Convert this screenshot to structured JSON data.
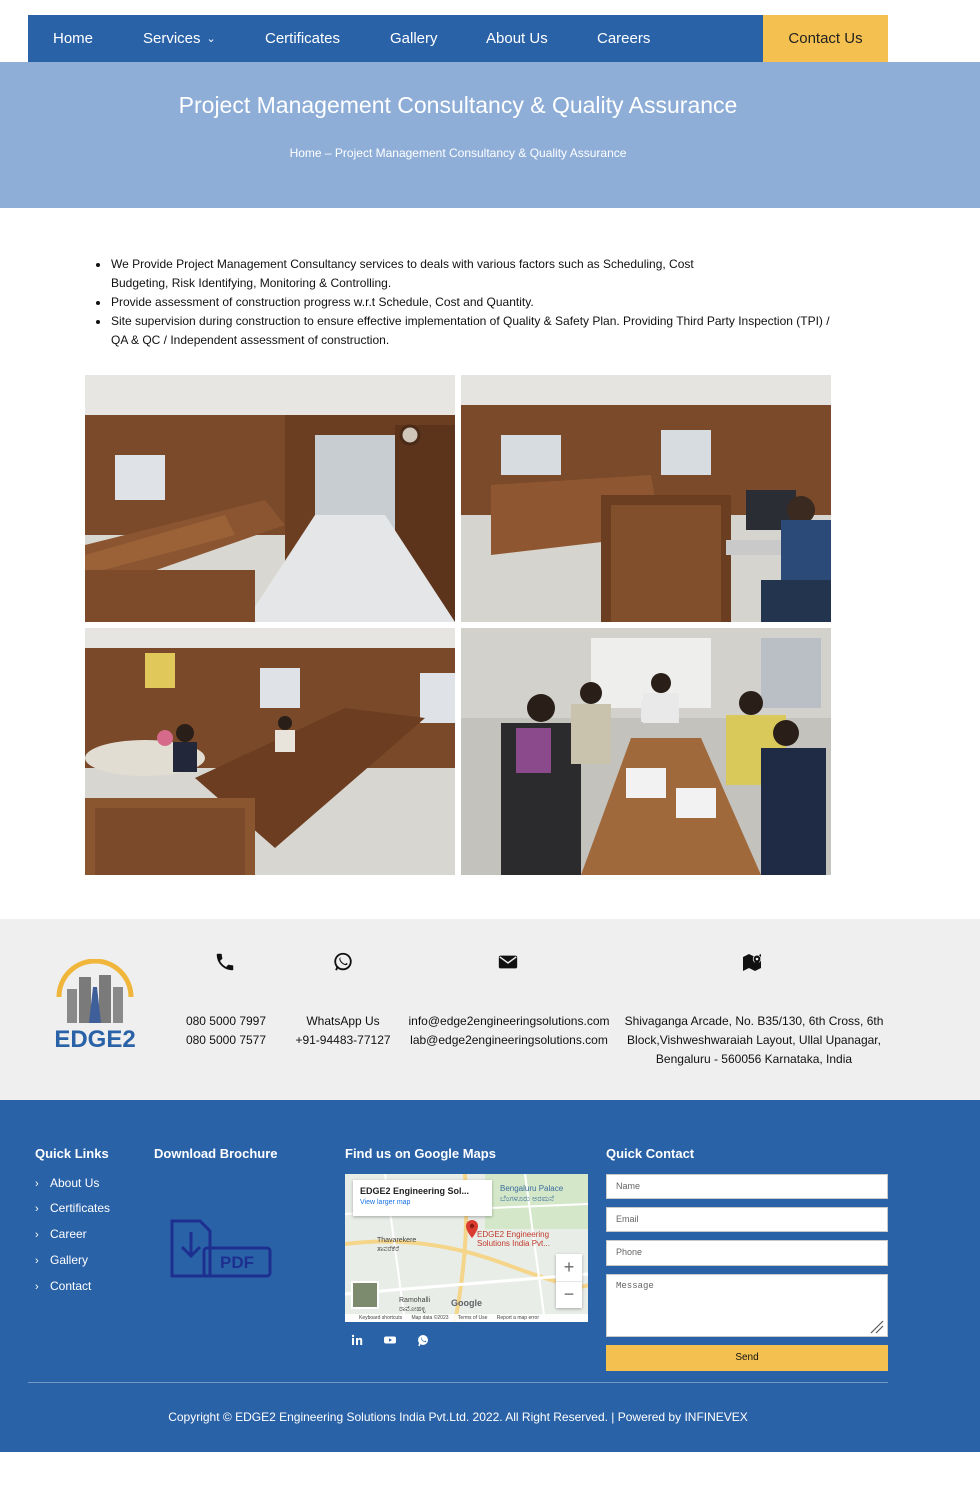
{
  "nav": {
    "items": [
      "Home",
      "Services",
      "Certificates",
      "Gallery",
      "About Us",
      "Careers"
    ],
    "contact_label": "Contact Us"
  },
  "hero": {
    "title": "Project Management Consultancy & Quality Assurance",
    "breadcrumb": "Home – Project Management Consultancy & Quality Assurance"
  },
  "services": [
    "We Provide Project Management Consultancy services to deals with various factors such as Scheduling, Cost Budgeting, Risk Identifying, Monitoring & Controlling.",
    "Provide assessment of construction progress w.r.t Schedule, Cost and Quantity.",
    "Site supervision during construction to ensure effective implementation of Quality & Safety Plan. Providing Third Party Inspection (TPI) / QA & QC / Independent assessment of construction."
  ],
  "gallery_icons": [
    "office-photo-1",
    "office-photo-2",
    "office-photo-3",
    "meeting-photo"
  ],
  "contact_info": {
    "phone_icon": "phone-icon",
    "phone": [
      "080 5000 7997",
      "080 5000 7577"
    ],
    "whatsapp_icon": "whatsapp-icon",
    "whatsapp_label": "WhatsApp Us",
    "whatsapp_number": "+91-94483-77127",
    "email_icon": "envelope-icon",
    "emails": [
      "info@edge2engineeringsolutions.com",
      "lab@edge2engineeringsolutions.com"
    ],
    "address_icon": "map-marker-icon",
    "address": [
      "Shivaganga Arcade, No. B35/130, 6th Cross, 6th",
      "Block,Vishweshwaraiah Layout, Ullal Upanagar,",
      "Bengaluru - 560056 Karnataka, India"
    ],
    "logo_text": "EDGE2"
  },
  "footer": {
    "quick_links_title": "Quick Links",
    "quick_links": [
      "About Us",
      "Certificates",
      "Career",
      "Gallery",
      "Contact"
    ],
    "brochure_title": "Download Brochure",
    "brochure_icon_label": "PDF",
    "maps_title": "Find us on Google Maps",
    "map": {
      "card_title": "EDGE2 Engineering Sol...",
      "card_link": "View larger map",
      "pin_label": "EDGE2 Engineering Solutions India Pvt...",
      "place_1": "Bengaluru Palace",
      "place_1_local": "ಬೆಂಗಳೂರು ಅರಮನೆ",
      "place_2": "Thavarekere",
      "place_2_local": "ತಾವರೆಕೆರೆ",
      "place_3": "Ramohalli",
      "place_3_local": "ರಾಮೋಹಳ್ಳಿ",
      "logo": "Google",
      "attribution": [
        "Keyboard shortcuts",
        "Map data ©2023",
        "Terms of Use",
        "Report a map error"
      ],
      "zoom_in": "+",
      "zoom_out": "−"
    },
    "quick_contact_title": "Quick Contact",
    "form": {
      "name_placeholder": "Name",
      "email_placeholder": "Email",
      "phone_placeholder": "Phone",
      "message_placeholder": "Message",
      "send_label": "Send"
    },
    "social_icons": [
      "linkedin-icon",
      "youtube-icon",
      "whatsapp-icon"
    ],
    "copyright": "Copyright © EDGE2 Engineering Solutions India Pvt.Ltd. 2022. All Right Reserved. | Powered by INFINEVEX"
  },
  "colors": {
    "primary": "#2a62a8",
    "accent": "#f4c150",
    "hero": "#8eaed8",
    "band": "#efefef"
  }
}
